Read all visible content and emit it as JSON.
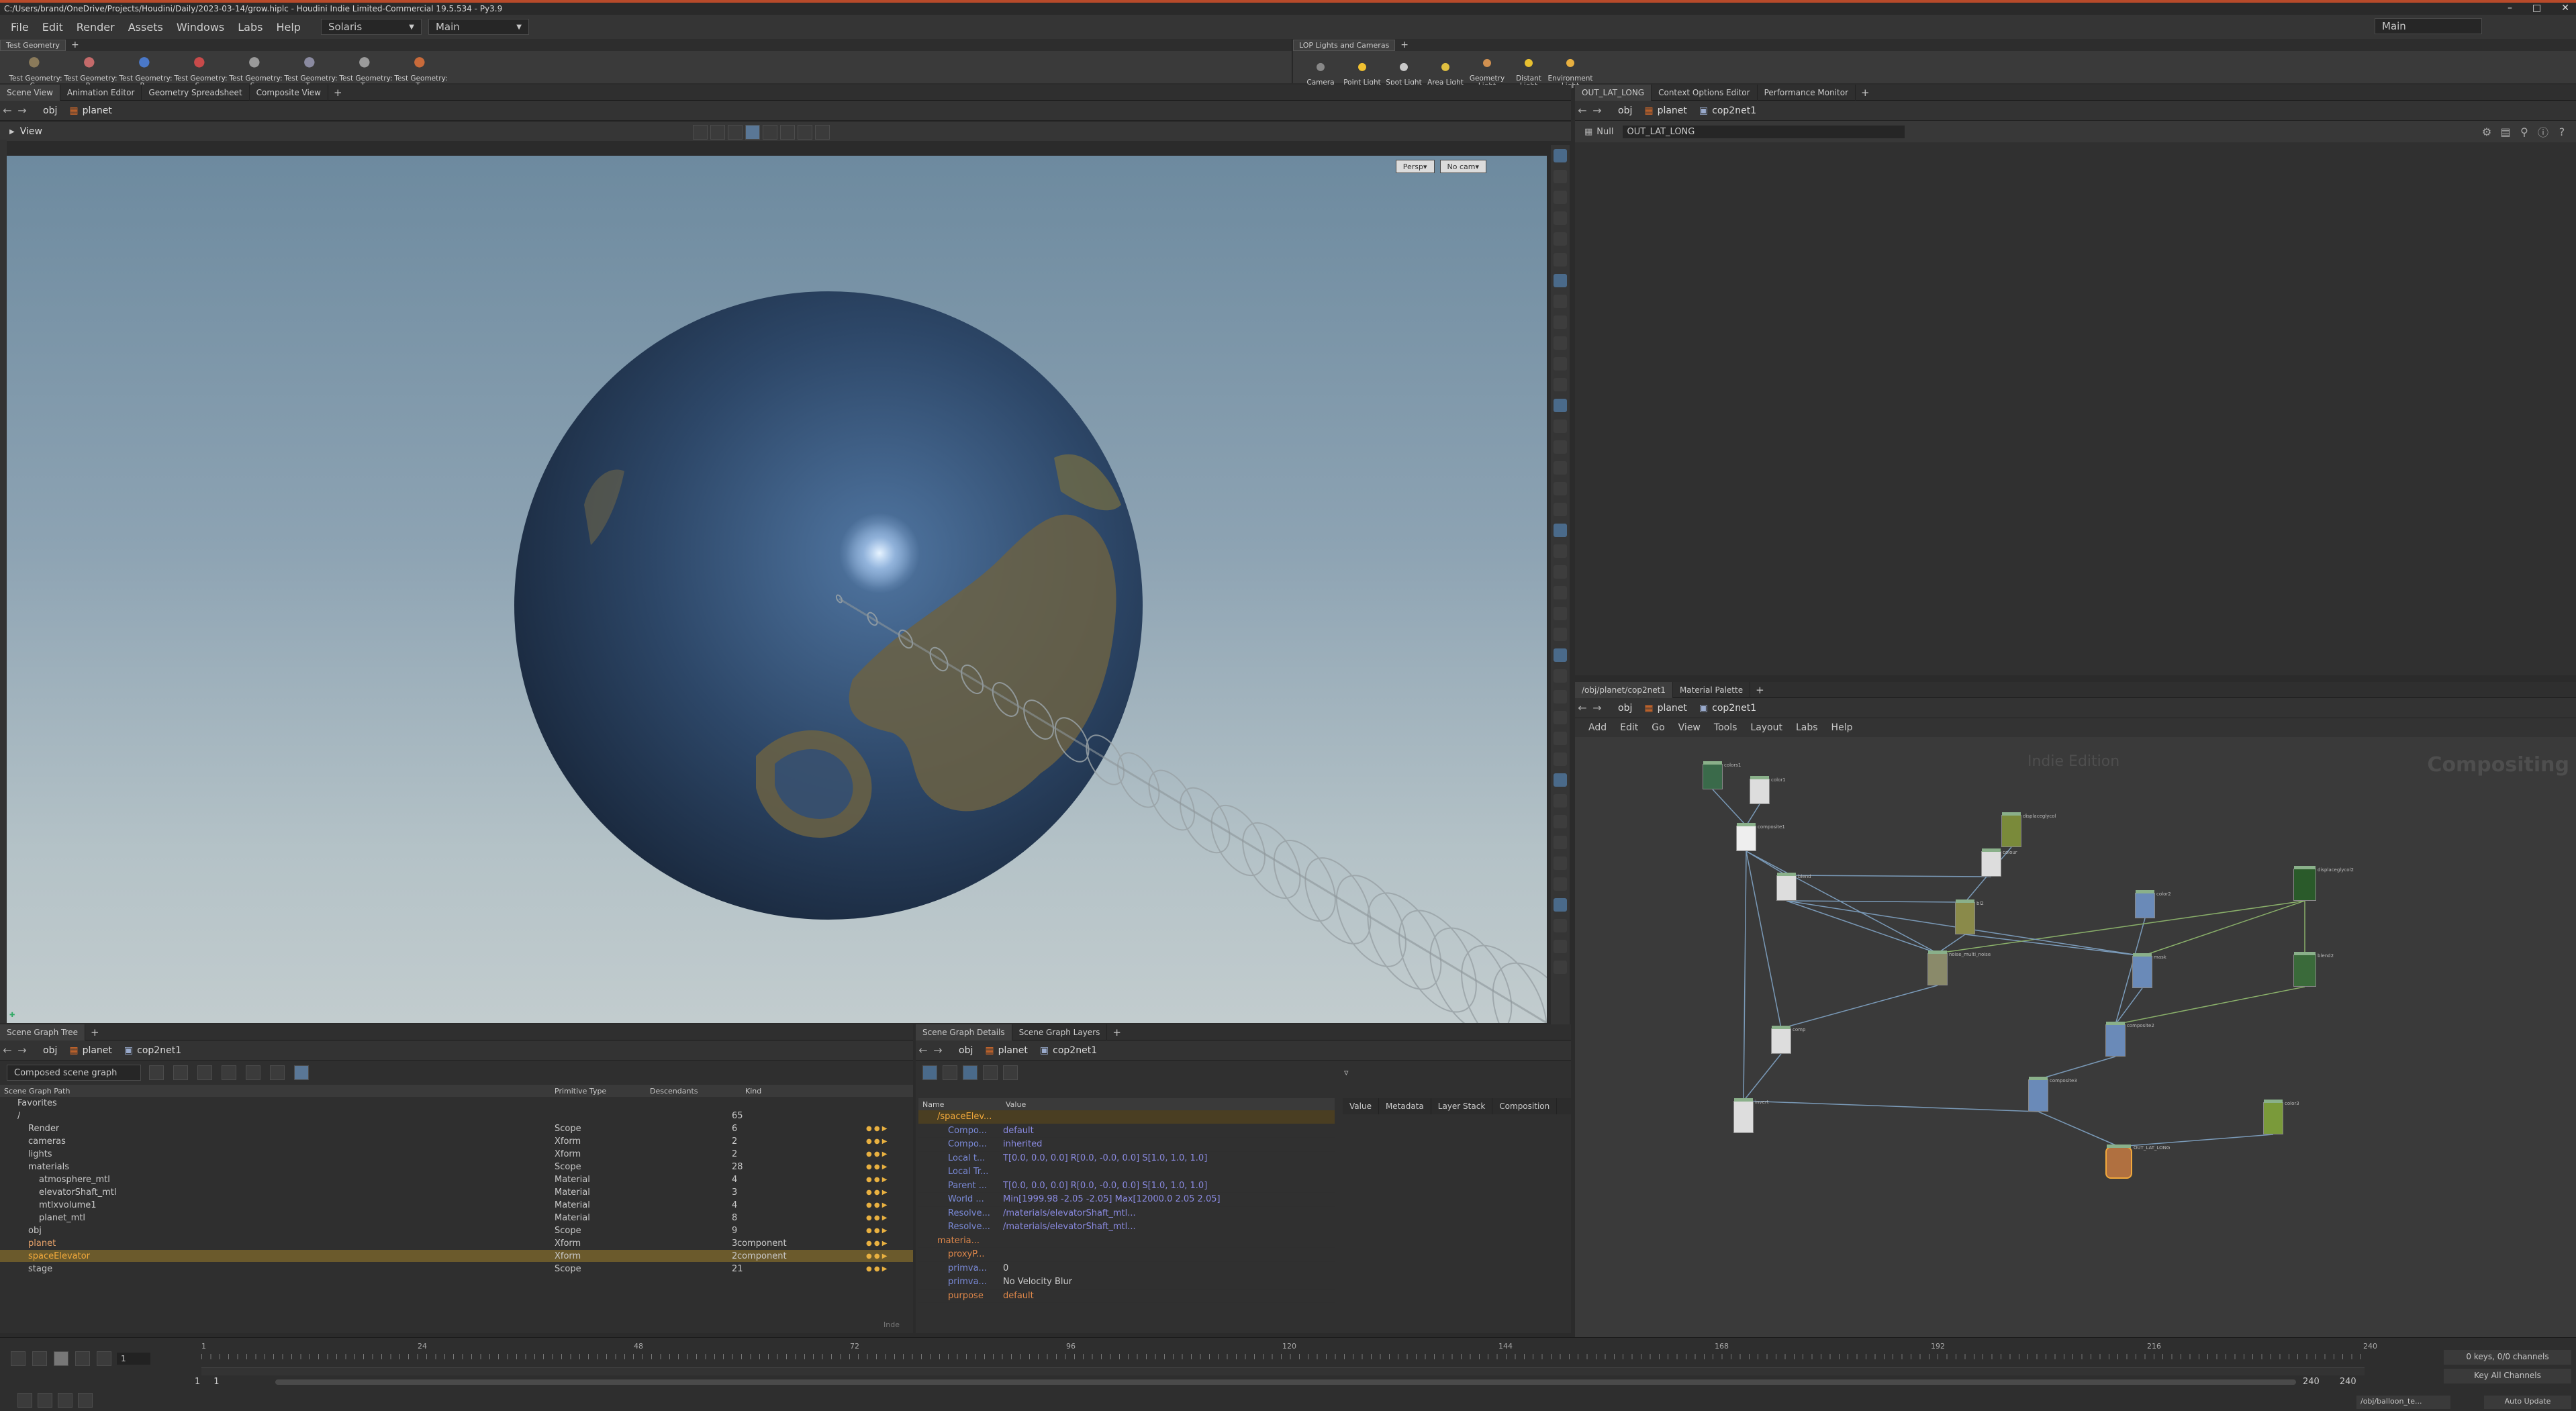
{
  "window": {
    "title": "C:/Users/brand/OneDrive/Projects/Houdini/Daily/2023-03-14/grow.hiplc - Houdini Indie Limited-Commercial 19.5.534 - Py3.9"
  },
  "menu": {
    "items": [
      "File",
      "Edit",
      "Render",
      "Assets",
      "Windows",
      "Labs",
      "Help"
    ],
    "desktop_dropdown": "Solaris",
    "context_dropdown": "Main",
    "right_dropdown": "Main"
  },
  "shelf_left": {
    "tab": "Test Geometry",
    "tools": [
      {
        "label": "Test Geometry: C...",
        "icon": "crag-icon"
      },
      {
        "label": "Test Geometry: P...",
        "icon": "pig-icon"
      },
      {
        "label": "Test Geometry: R...",
        "icon": "rubbertoy-icon"
      },
      {
        "label": "Test Geometry: S...",
        "icon": "shaderball-icon"
      },
      {
        "label": "Test Geometry: S...",
        "icon": "squab-icon"
      },
      {
        "label": "Test Geometry: T...",
        "icon": "template-icon"
      },
      {
        "label": "Test Geometry: T...",
        "icon": "tommy-icon"
      },
      {
        "label": "Test Geometry: T...",
        "icon": "toy-icon"
      }
    ]
  },
  "shelf_right": {
    "tab": "LOP Lights and Cameras",
    "tools": [
      {
        "label": "Camera",
        "icon": "camera-icon"
      },
      {
        "label": "Point Light",
        "icon": "point-light-icon"
      },
      {
        "label": "Spot Light",
        "icon": "spot-light-icon"
      },
      {
        "label": "Area Light",
        "icon": "area-light-icon"
      },
      {
        "label": "Geometry Light",
        "icon": "geometry-light-icon"
      },
      {
        "label": "Distant Light",
        "icon": "distant-light-icon"
      },
      {
        "label": "Environment Light",
        "icon": "environment-light-icon"
      }
    ]
  },
  "viewport_tabs": [
    "Scene View",
    "Animation Editor",
    "Geometry Spreadsheet",
    "Composite View"
  ],
  "viewport_path": [
    "obj",
    "planet"
  ],
  "viewport": {
    "title": "View",
    "persp": "Persp",
    "cam": "No cam"
  },
  "right_top_tabs": [
    "OUT_LAT_LONG",
    "Context Options Editor",
    "Performance Monitor"
  ],
  "right_top_path": [
    "obj",
    "planet",
    "cop2net1"
  ],
  "parm": {
    "type": "Null",
    "name": "OUT_LAT_LONG"
  },
  "network_tabs": [
    "/obj/planet/cop2net1",
    "Material Palette"
  ],
  "network_path": [
    "obj",
    "planet",
    "cop2net1"
  ],
  "network_menu": [
    "Add",
    "Edit",
    "Go",
    "View",
    "Tools",
    "Layout",
    "Labs",
    "Help"
  ],
  "network": {
    "watermark": "Indie Edition",
    "context": "Compositing"
  },
  "sgt": {
    "tabs": [
      "Scene Graph Tree"
    ],
    "path": [
      "obj",
      "planet",
      "cop2net1"
    ],
    "dropdown": "Composed scene graph",
    "columns": [
      "Scene Graph Path",
      "Primitive Type",
      "Descendants",
      "Kind",
      "P",
      "L",
      "D",
      "S",
      "C"
    ],
    "rows": [
      {
        "name": "Favorites",
        "type": "",
        "desc": "",
        "kind": ""
      },
      {
        "name": "/",
        "type": "",
        "desc": "65",
        "kind": ""
      },
      {
        "name": "Render",
        "type": "Scope",
        "desc": "6",
        "kind": ""
      },
      {
        "name": "cameras",
        "type": "Xform",
        "desc": "2",
        "kind": ""
      },
      {
        "name": "lights",
        "type": "Xform",
        "desc": "2",
        "kind": ""
      },
      {
        "name": "materials",
        "type": "Scope",
        "desc": "28",
        "kind": ""
      },
      {
        "name": "atmosphere_mtl",
        "type": "Material",
        "desc": "4",
        "kind": ""
      },
      {
        "name": "elevatorShaft_mtl",
        "type": "Material",
        "desc": "3",
        "kind": ""
      },
      {
        "name": "mtlxvolume1",
        "type": "Material",
        "desc": "4",
        "kind": ""
      },
      {
        "name": "planet_mtl",
        "type": "Material",
        "desc": "8",
        "kind": ""
      },
      {
        "name": "obj",
        "type": "Scope",
        "desc": "9",
        "kind": ""
      },
      {
        "name": "planet",
        "type": "Xform",
        "desc": "3",
        "kind": "component"
      },
      {
        "name": "spaceElevator",
        "type": "Xform",
        "desc": "2",
        "kind": "component"
      },
      {
        "name": "stage",
        "type": "Scope",
        "desc": "21",
        "kind": ""
      }
    ],
    "footer": "Inde"
  },
  "sgd": {
    "tabs": [
      "Scene Graph Details",
      "Scene Graph Layers"
    ],
    "path": [
      "obj",
      "planet",
      "cop2net1"
    ],
    "columns": [
      "Name",
      "Value"
    ],
    "rows": [
      {
        "name": "/spaceElev...",
        "value": ""
      },
      {
        "name": "Compo...",
        "value": "default"
      },
      {
        "name": "Compo...",
        "value": "inherited"
      },
      {
        "name": "Local t...",
        "value": "T[0.0, 0.0, 0.0] R[0.0, -0.0, 0.0] S[1.0, 1.0, 1.0]"
      },
      {
        "name": "Local Tr...",
        "value": ""
      },
      {
        "name": "Parent ...",
        "value": "T[0.0, 0.0, 0.0] R[0.0, -0.0, 0.0] S[1.0, 1.0, 1.0]"
      },
      {
        "name": "World ...",
        "value": "Min[1999.98 -2.05 -2.05] Max[12000.0 2.05 2.05]"
      },
      {
        "name": "Resolve...",
        "value": "/materials/elevatorShaft_mtl..."
      },
      {
        "name": "Resolve...",
        "value": "/materials/elevatorShaft_mtl..."
      },
      {
        "name": "materia...",
        "value": ""
      },
      {
        "name": "proxyP...",
        "value": ""
      },
      {
        "name": "primva...",
        "value": "0"
      },
      {
        "name": "primva...",
        "value": "No Velocity Blur"
      },
      {
        "name": "purpose",
        "value": "default"
      }
    ],
    "side_tabs": [
      "Value",
      "Metadata",
      "Layer Stack",
      "Composition"
    ]
  },
  "timeline": {
    "ticks": [
      "1",
      "24",
      "48",
      "72",
      "96",
      "120",
      "144",
      "168",
      "192",
      "216",
      "240"
    ],
    "frame": "1",
    "range_start": "1",
    "range_start2": "1",
    "range_end": "240",
    "range_end2": "240",
    "keys_label": "0 keys, 0/0 channels",
    "key_all": "Key All Channels",
    "status_path": "/obj/balloon_te...",
    "auto_update": "Auto Update"
  },
  "nodes": [
    {
      "label": "colors1"
    },
    {
      "label": "color1"
    },
    {
      "label": "composite1"
    },
    {
      "label": "displaceglycol"
    },
    {
      "label": "colour"
    },
    {
      "label": "blend"
    },
    {
      "label": "bl2"
    },
    {
      "label": "color2"
    },
    {
      "label": "displaceglycol2"
    },
    {
      "label": "noise_multi_noise"
    },
    {
      "label": "mask"
    },
    {
      "label": "blend2"
    },
    {
      "label": "composite2"
    },
    {
      "label": "comp"
    },
    {
      "label": "composite3"
    },
    {
      "label": "invert"
    },
    {
      "label": "color3"
    },
    {
      "label": "OUT_LAT_LONG"
    }
  ],
  "colors": {
    "accent": "#f2a93b",
    "selection": "#6b5a2c",
    "titlebar_stripe": "#b84a2a"
  }
}
